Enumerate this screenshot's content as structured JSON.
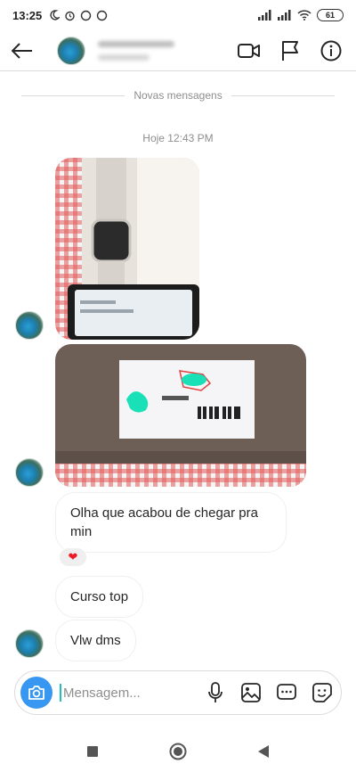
{
  "status_bar": {
    "time": "13:25",
    "battery": "61"
  },
  "header": {
    "back_icon": "arrow-left-icon",
    "action_icons": [
      "video-call-icon",
      "flag-icon",
      "info-icon"
    ]
  },
  "thread": {
    "new_messages_label": "Novas mensagens",
    "timestamp": "Hoje 12:43 PM",
    "messages": [
      {
        "type": "photo",
        "content": "smartwatch-box-photo"
      },
      {
        "type": "photo",
        "content": "package-label-photo"
      },
      {
        "type": "text",
        "text": "Olha que acabou de chegar pra min",
        "reaction": "heart"
      },
      {
        "type": "text",
        "text": "Curso top"
      },
      {
        "type": "text",
        "text": "Vlw dms"
      }
    ]
  },
  "composer": {
    "placeholder": "Mensagem...",
    "icons": [
      "camera-icon",
      "microphone-icon",
      "gallery-icon",
      "chat-options-icon",
      "sticker-icon"
    ]
  },
  "nav": {
    "icons": [
      "recents-square-icon",
      "home-circle-icon",
      "back-triangle-icon"
    ]
  },
  "colors": {
    "accent": "#3897f0",
    "reaction_heart": "#ed1c24",
    "bubble_border": "#efefef",
    "secondary_text": "#8e8e8e"
  }
}
